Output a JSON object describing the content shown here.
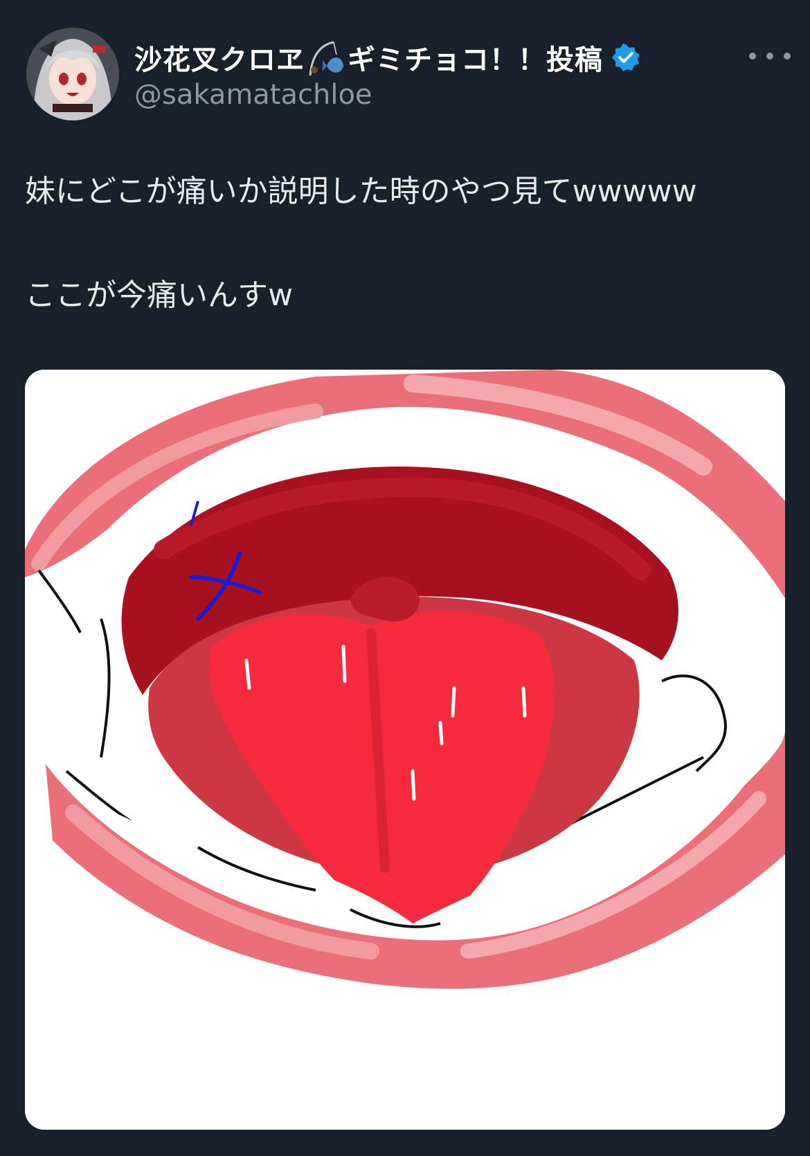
{
  "author": {
    "display_name_part1": "沙花叉クロヱ",
    "display_name_part2": "ギミチョコ！！投稿",
    "handle": "@sakamatachloe",
    "verified_color": "#1d9bf0",
    "avatar_icon": "avatar-anime-girl",
    "name_emoji_icon": "fishing-pole-fish-icon"
  },
  "tweet": {
    "line1": "妹にどこが痛いか説明した時のやつ見てwwwww",
    "line2": "ここが今痛いんすw"
  },
  "media": {
    "description_icon": "mouth-drawing-image"
  },
  "colors": {
    "background": "#17202b",
    "text": "#e7e9ea",
    "secondary_text": "#8b98a5",
    "accent": "#1d9bf0"
  }
}
